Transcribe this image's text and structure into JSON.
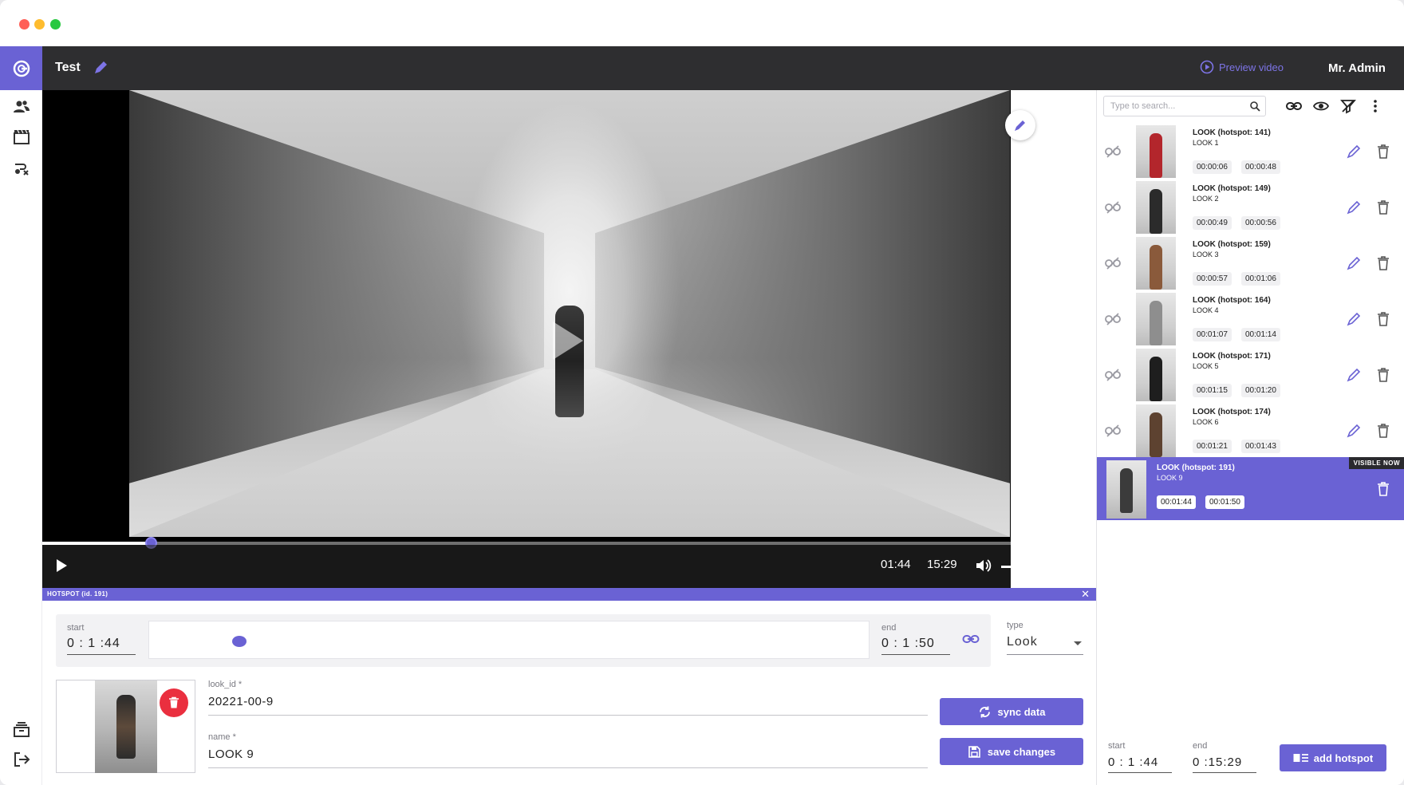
{
  "header": {
    "project_title": "Test",
    "preview_label": "Preview video",
    "user_name": "Mr. Admin"
  },
  "player": {
    "current_time": "01:44",
    "total_time": "15:29",
    "progress": 0.112,
    "volume": 0.87
  },
  "hotspot_editor": {
    "bar_label": "HOTSPOT   (id. 191)",
    "start_label": "start",
    "start_value": "0 : 1 :44",
    "end_label": "end",
    "end_value": "0 : 1 :50",
    "type_label": "type",
    "type_value": "Look",
    "look_id_label": "look_id *",
    "look_id_value": "20221-00-9",
    "name_label": "name *",
    "name_value": "LOOK 9",
    "sync_label": "sync data",
    "save_label": "save changes"
  },
  "panel": {
    "search_placeholder": "Type to search...",
    "visible_badge": "VISIBLE NOW",
    "items": [
      {
        "title": "LOOK (hotspot: 141)",
        "sub": "LOOK 1",
        "start": "00:00:06",
        "end": "00:00:48",
        "active": false,
        "figure_color": "#b3262c"
      },
      {
        "title": "LOOK (hotspot: 149)",
        "sub": "LOOK 2",
        "start": "00:00:49",
        "end": "00:00:56",
        "active": false,
        "figure_color": "#2b2b2b"
      },
      {
        "title": "LOOK (hotspot: 159)",
        "sub": "LOOK 3",
        "start": "00:00:57",
        "end": "00:01:06",
        "active": false,
        "figure_color": "#8a5a3b"
      },
      {
        "title": "LOOK (hotspot: 164)",
        "sub": "LOOK 4",
        "start": "00:01:07",
        "end": "00:01:14",
        "active": false,
        "figure_color": "#8e8e8e"
      },
      {
        "title": "LOOK (hotspot: 171)",
        "sub": "LOOK 5",
        "start": "00:01:15",
        "end": "00:01:20",
        "active": false,
        "figure_color": "#1e1e1e"
      },
      {
        "title": "LOOK (hotspot: 174)",
        "sub": "LOOK 6",
        "start": "00:01:21",
        "end": "00:01:43",
        "active": false,
        "figure_color": "#5d4230"
      },
      {
        "title": "LOOK (hotspot: 191)",
        "sub": "LOOK 9",
        "start": "00:01:44",
        "end": "00:01:50",
        "active": true,
        "figure_color": "#3b3b3b"
      }
    ],
    "footer": {
      "start_label": "start",
      "start_value": "0 : 1 :44",
      "end_label": "end",
      "end_value": "0 :15:29",
      "add_label": "add hotspot"
    }
  },
  "colors": {
    "accent": "#6a62d4",
    "danger": "#ea2f3f",
    "topbar": "#2e2e30"
  }
}
